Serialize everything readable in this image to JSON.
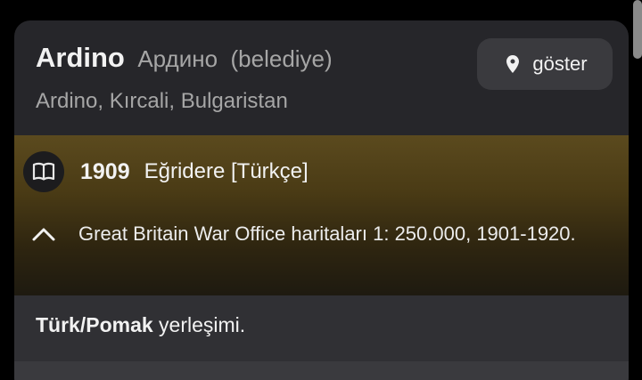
{
  "place": {
    "name": "Ardino",
    "alt_name": "Ардино",
    "type": "(belediye)",
    "location": "Ardino, Kırcali, Bulgaristan"
  },
  "show_button": {
    "label": "göster",
    "icon": "map-pin-icon"
  },
  "source": {
    "icon": "book-icon",
    "year": "1909",
    "name": "Eğridere [Türkçe]",
    "collapse_icon": "chevron-up-icon",
    "description": "Great Britain War Office haritaları 1: 250.000, 1901-1920."
  },
  "note": {
    "strong": "Türk/Pomak",
    "rest": " yerleşimi."
  },
  "colors": {
    "card_bg": "#26262a",
    "source_gold": "#5b4a1e",
    "button_bg": "#3a3a3e"
  }
}
